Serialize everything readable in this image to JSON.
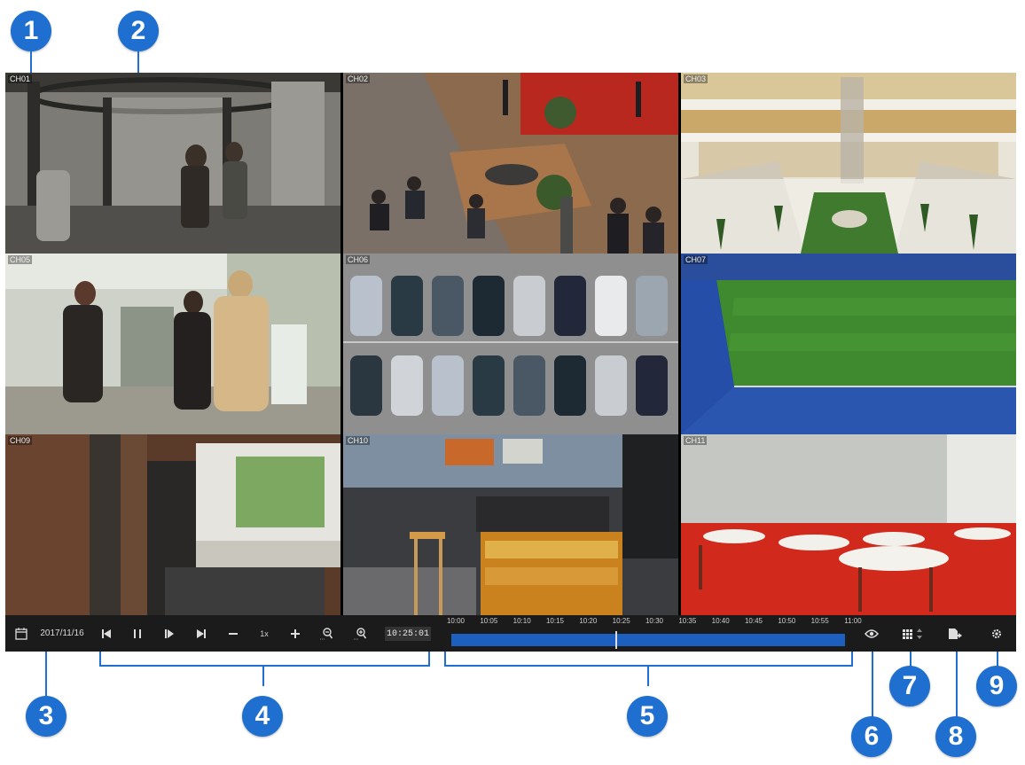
{
  "callouts": [
    "1",
    "2",
    "3",
    "4",
    "5",
    "6",
    "7",
    "8",
    "9"
  ],
  "channels": [
    {
      "label": "CH01",
      "scene": "revolving-door-entrance"
    },
    {
      "label": "CH02",
      "scene": "lobby-seating-area"
    },
    {
      "label": "CH03",
      "scene": "mall-atrium"
    },
    {
      "label": "CH05",
      "scene": "shoppers-escalator"
    },
    {
      "label": "CH06",
      "scene": "parking-lot"
    },
    {
      "label": "CH07",
      "scene": "football-stadium"
    },
    {
      "label": "CH09",
      "scene": "elevator-hall"
    },
    {
      "label": "CH10",
      "scene": "cafe-counter"
    },
    {
      "label": "CH11",
      "scene": "cafeteria"
    }
  ],
  "toolbar": {
    "date": "2017/11/16",
    "speed": "1x",
    "current_time": "10:25:01",
    "timeline_ticks": [
      "10:00",
      "10:05",
      "10:10",
      "10:15",
      "10:20",
      "10:25",
      "10:30",
      "10:35",
      "10:40",
      "10:45",
      "10:50",
      "10:55",
      "11:00"
    ],
    "cursor_fraction": 0.417
  },
  "icons": [
    "calendar-icon",
    "skip-back-icon",
    "pause-icon",
    "slow-play-icon",
    "skip-forward-icon",
    "speed-down-icon",
    "speed-up-icon",
    "zoom-out-icon",
    "zoom-in-icon",
    "view-icon",
    "layout-grid-icon",
    "export-icon",
    "settings-icon"
  ],
  "colors": {
    "accent": "#1e6fcf",
    "timebar": "#1c5fbf",
    "toolbar_bg": "#1b1b1b"
  }
}
